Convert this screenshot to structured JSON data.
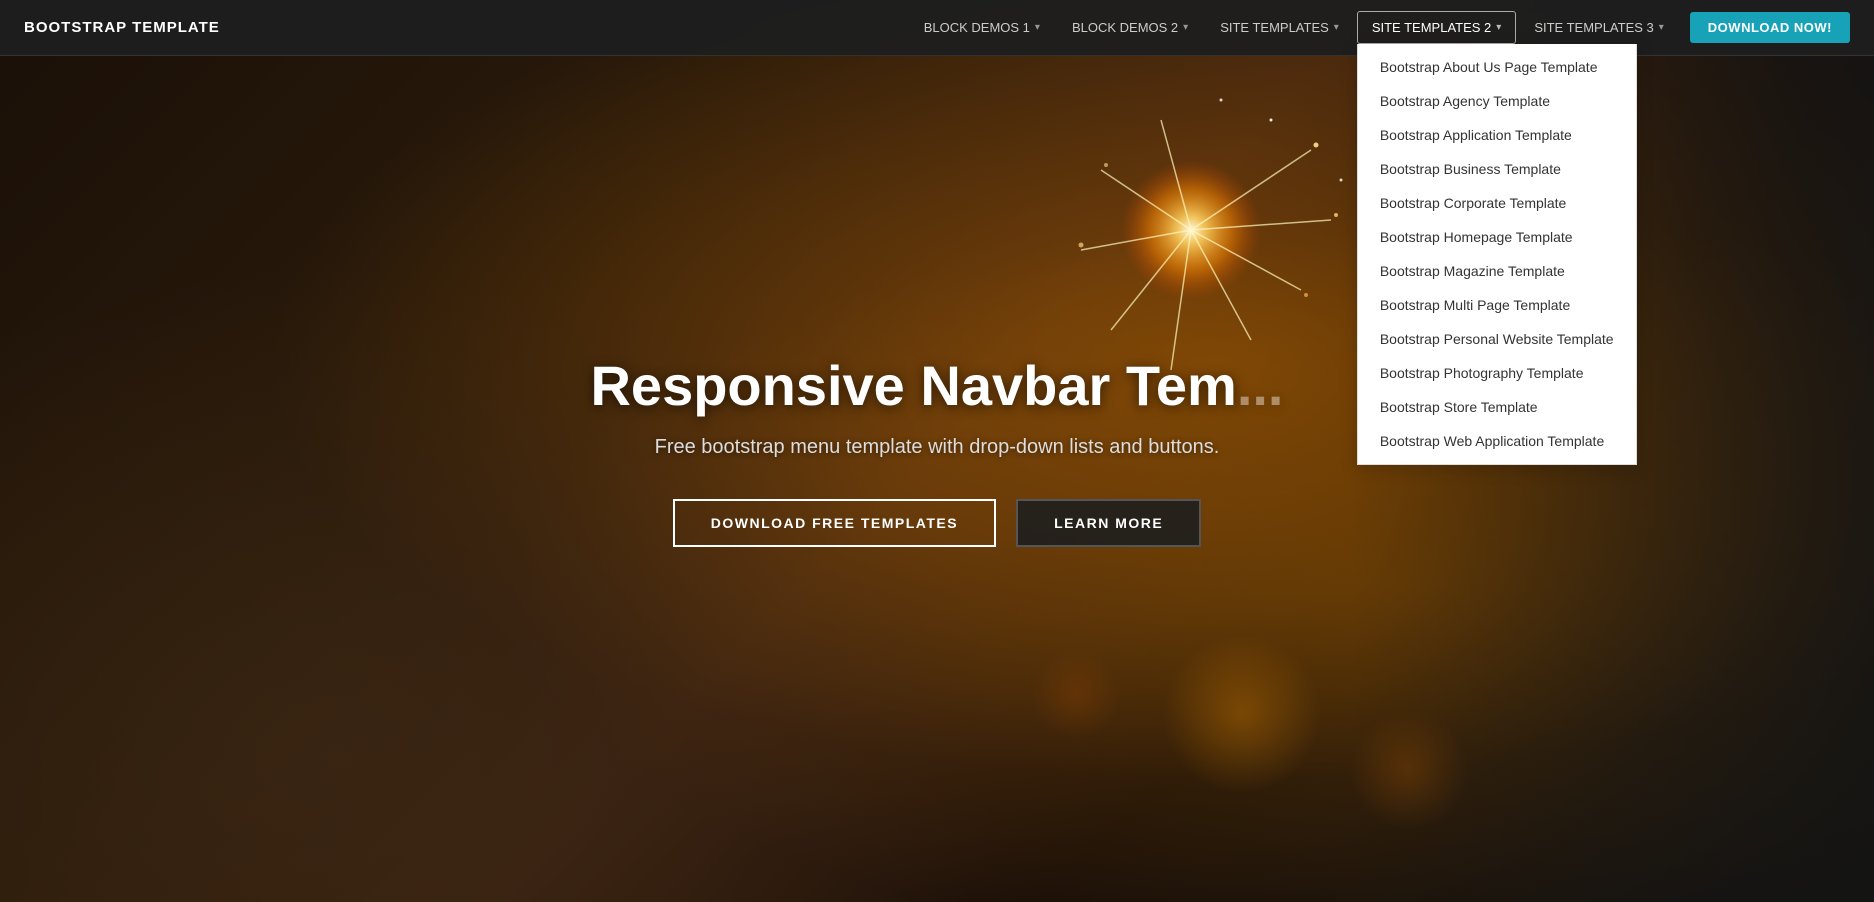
{
  "brand": "BOOTSTRAP TEMPLATE",
  "nav": {
    "links": [
      {
        "id": "block-demos-1",
        "label": "BLOCK DEMOS 1",
        "hasCaret": true
      },
      {
        "id": "block-demos-2",
        "label": "BLOCK DEMOS 2",
        "hasCaret": true
      },
      {
        "id": "site-templates",
        "label": "SITE TEMPLATES",
        "hasCaret": true
      },
      {
        "id": "site-templates-2",
        "label": "SITE TEMPLATES 2",
        "hasCaret": true,
        "active": true
      },
      {
        "id": "site-templates-3",
        "label": "SITE TEMPLATES 3",
        "hasCaret": true
      }
    ],
    "download_button": "DOWNLOAD NOW!"
  },
  "dropdown": {
    "items": [
      "Bootstrap About Us Page Template",
      "Bootstrap Agency Template",
      "Bootstrap Application Template",
      "Bootstrap Business Template",
      "Bootstrap Corporate Template",
      "Bootstrap Homepage Template",
      "Bootstrap Magazine Template",
      "Bootstrap Multi Page Template",
      "Bootstrap Personal Website Template",
      "Bootstrap Photography Template",
      "Bootstrap Store Template",
      "Bootstrap Web Application Template"
    ]
  },
  "hero": {
    "title": "Responsive Navbar Tem...",
    "title_full": "Responsive Navbar Template",
    "subtitle": "Free bootstrap menu template with drop-down lists and buttons.",
    "btn_primary": "DOWNLOAD FREE TEMPLATES",
    "btn_secondary": "LEARN MORE"
  },
  "colors": {
    "download_btn": "#17a2b8",
    "active_border": "#aaaaaa"
  }
}
